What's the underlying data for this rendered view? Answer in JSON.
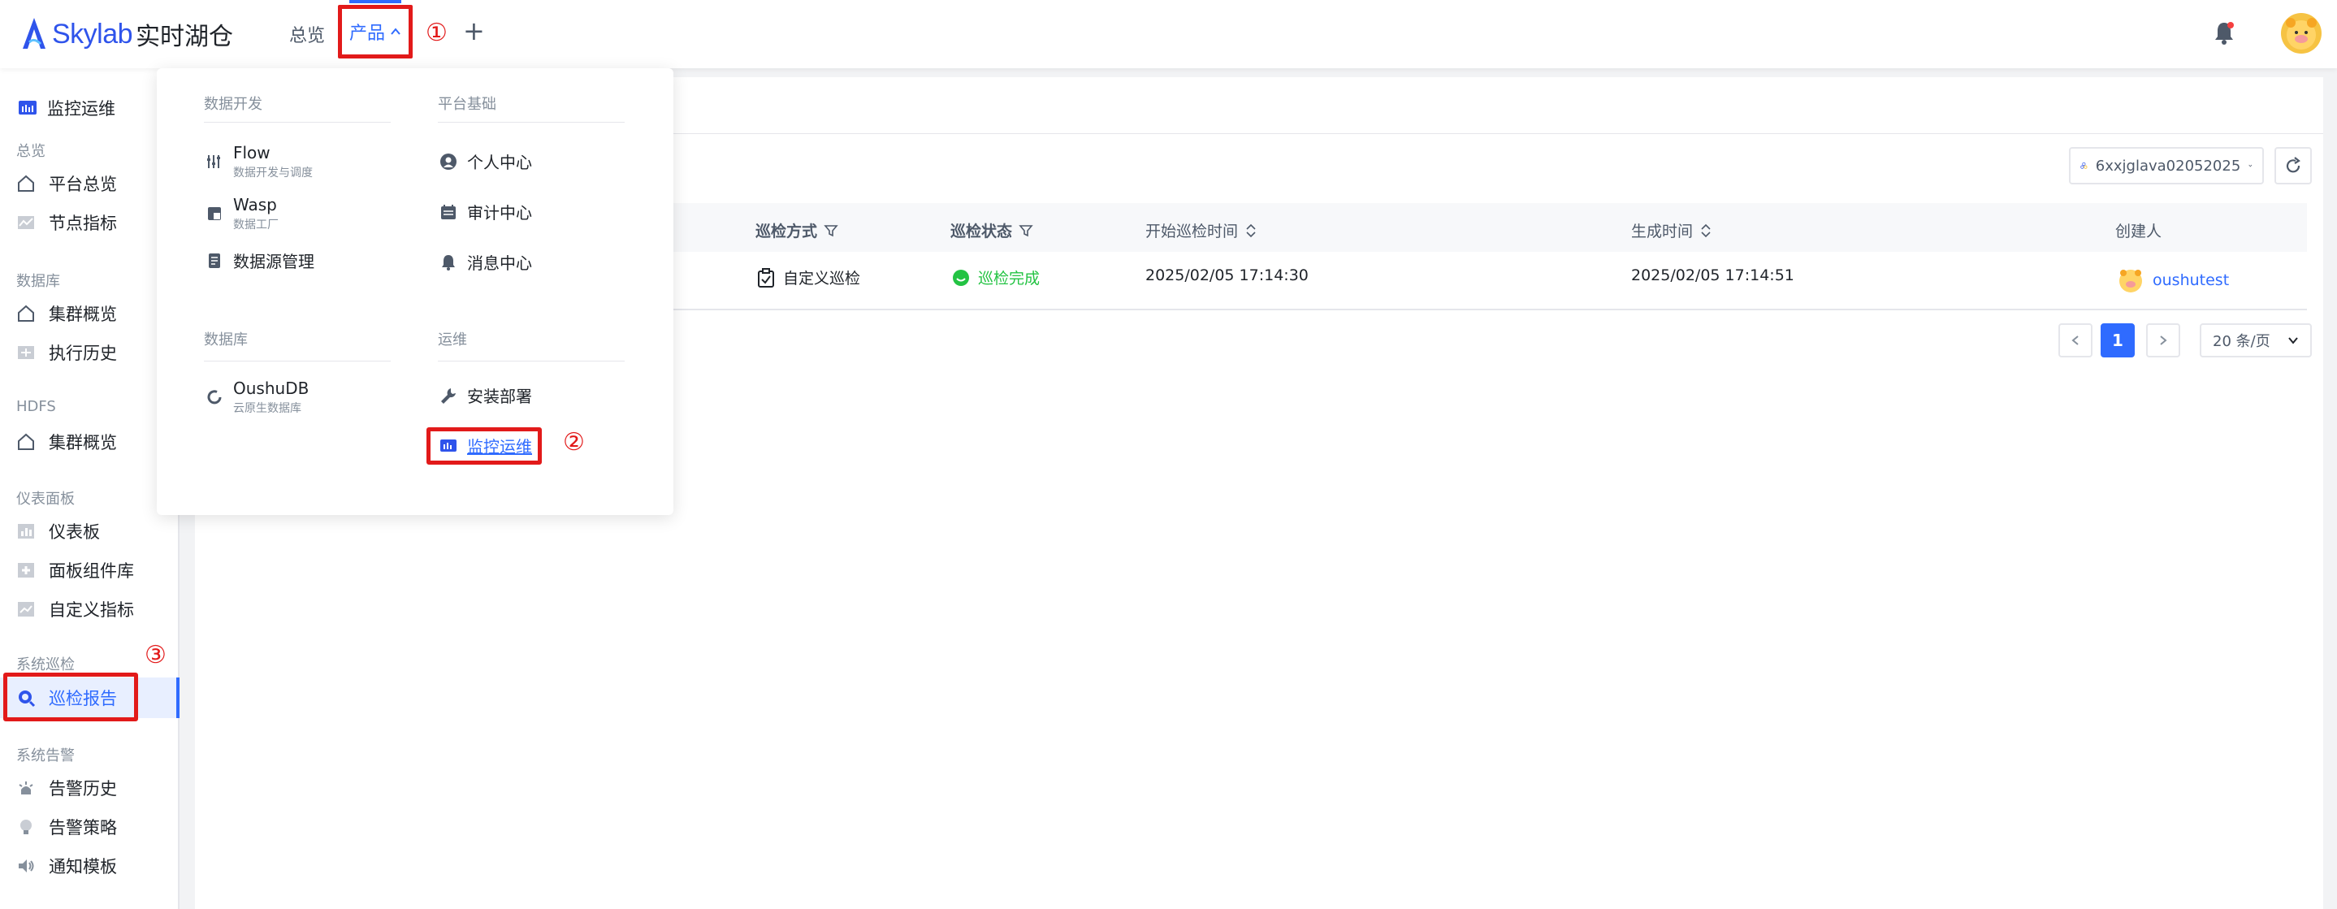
{
  "header": {
    "logo_text": "Skylab",
    "logo_text_cn": "实时湖仓",
    "nav_overview": "总览",
    "nav_product": "产品",
    "plus_label": "+",
    "annotation_1": "①",
    "annotation_2": "②",
    "annotation_3": "③"
  },
  "sidebar": {
    "title": "监控运维",
    "groups": {
      "overview": "总览",
      "database": "数据库",
      "hdfs": "HDFS",
      "dashboard": "仪表面板",
      "inspection": "系统巡检",
      "alert": "系统告警"
    },
    "items": {
      "platform_overview": "平台总览",
      "node_metrics": "节点指标",
      "cluster_overview_db": "集群概览",
      "exec_history": "执行历史",
      "cluster_overview_hdfs": "集群概览",
      "dashboard": "仪表板",
      "panel_library": "面板组件库",
      "custom_metrics": "自定义指标",
      "inspection_report": "巡检报告",
      "alert_history": "告警历史",
      "alert_policy": "告警策略",
      "notify_template": "通知模板"
    }
  },
  "dropdown": {
    "group_dev": "数据开发",
    "group_platform": "平台基础",
    "group_db": "数据库",
    "group_ops": "运维",
    "flow": {
      "title": "Flow",
      "sub": "数据开发与调度"
    },
    "wasp": {
      "title": "Wasp",
      "sub": "数据工厂"
    },
    "datasource": "数据源管理",
    "oushudb": {
      "title": "OushuDB",
      "sub": "云原生数据库"
    },
    "personal_center": "个人中心",
    "audit_center": "审计中心",
    "message_center": "消息中心",
    "install_deploy": "安装部署",
    "monitor_ops": "监控运维"
  },
  "toolbar": {
    "cluster_name": "6xxjglava02052025"
  },
  "table": {
    "columns": {
      "method": "巡检方式",
      "status": "巡检状态",
      "start_time": "开始巡检时间",
      "gen_time": "生成时间",
      "creator": "创建人"
    },
    "row": {
      "method": "自定义巡检",
      "status": "巡检完成",
      "start_time": "2025/02/05 17:14:30",
      "gen_time": "2025/02/05 17:14:51",
      "creator": "oushutest"
    }
  },
  "pagination": {
    "current_page": "1",
    "page_size": "20 条/页"
  },
  "colors": {
    "accent": "#2f6bff",
    "annotation_red": "#e21a1a",
    "success": "#23c343"
  }
}
